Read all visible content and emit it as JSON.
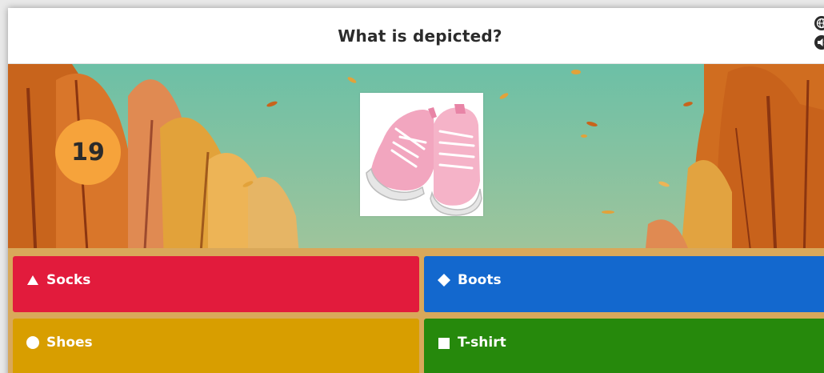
{
  "question": {
    "text": "What is depicted?"
  },
  "header_icons": [
    "globe-icon",
    "speaker-icon"
  ],
  "timer": {
    "value": "19",
    "color": "#f6a33b"
  },
  "question_image": {
    "subject": "pink sneakers"
  },
  "answers": [
    {
      "label": "Socks",
      "shape": "triangle-icon",
      "color": "#e21b3c"
    },
    {
      "label": "Boots",
      "shape": "diamond-icon",
      "color": "#1368ce"
    },
    {
      "label": "Shoes",
      "shape": "circle-icon",
      "color": "#d89e00"
    },
    {
      "label": "T-shirt",
      "shape": "square-icon",
      "color": "#26890c"
    }
  ]
}
